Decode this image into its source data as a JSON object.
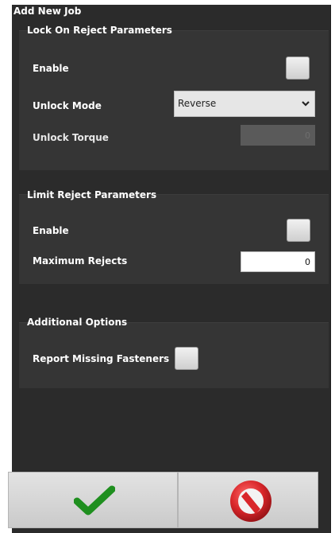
{
  "window": {
    "title": "Add New Job"
  },
  "lock_on_reject": {
    "legend": "Lock On Reject Parameters",
    "enable_label": "Enable",
    "enable_checked": false,
    "unlock_mode_label": "Unlock Mode",
    "unlock_mode_value": "Reverse",
    "unlock_torque_label": "Unlock Torque",
    "unlock_torque_value": "0"
  },
  "limit_reject": {
    "legend": "Limit Reject Parameters",
    "enable_label": "Enable",
    "enable_checked": false,
    "max_rejects_label": "Maximum Rejects",
    "max_rejects_value": "0"
  },
  "additional": {
    "legend": "Additional Options",
    "report_missing_label": "Report Missing Fasteners",
    "report_missing_checked": false
  },
  "footer": {
    "confirm_icon": "checkmark-icon",
    "cancel_icon": "no-entry-icon",
    "confirm_color": "#1f8f1f",
    "cancel_color": "#d9262a"
  }
}
